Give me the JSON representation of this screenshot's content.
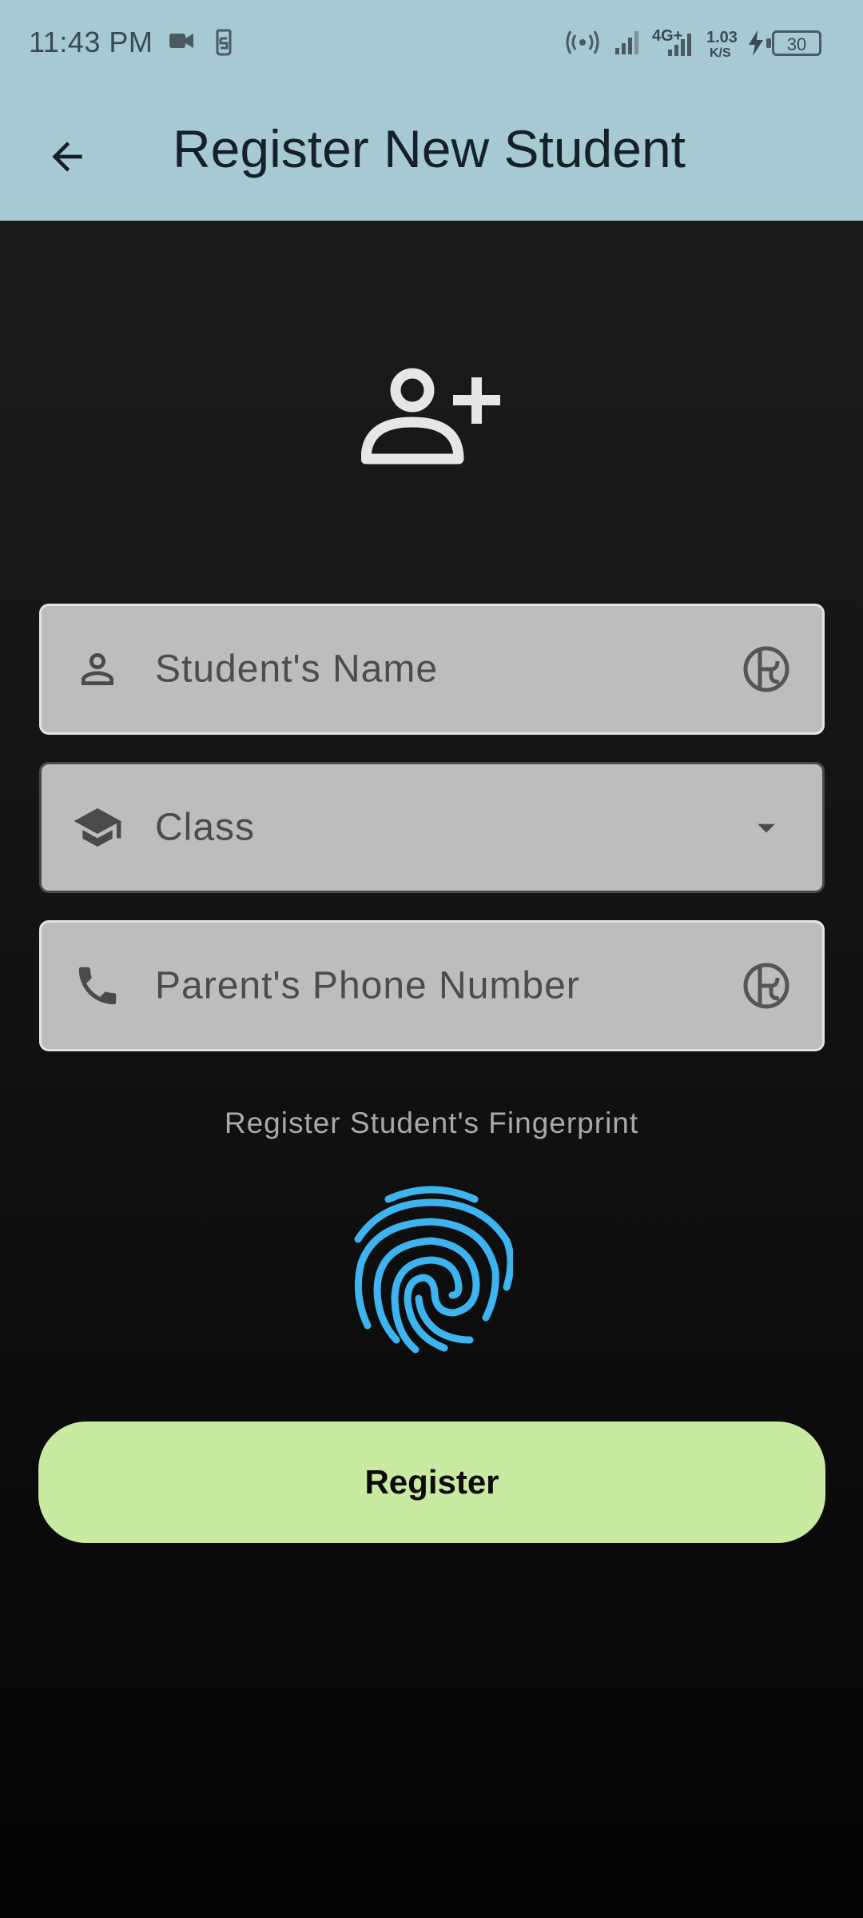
{
  "status_bar": {
    "time": "11:43 PM",
    "network_type": "4G+",
    "speed_value": "1.03",
    "speed_unit": "K/S",
    "battery": "30"
  },
  "app_bar": {
    "title": "Register New Student",
    "back_icon": "arrow-back-icon"
  },
  "form": {
    "hero_icon": "person-add-icon",
    "student_name": {
      "placeholder": "Student's Name",
      "value": ""
    },
    "class_select": {
      "placeholder": "Class",
      "value": ""
    },
    "parent_phone": {
      "placeholder": "Parent's Phone Number",
      "value": ""
    },
    "fingerprint_caption": "Register Student's Fingerprint",
    "register_label": "Register"
  },
  "colors": {
    "header_bg": "#a6c9d4",
    "field_bg": "#bdbdbd",
    "fingerprint": "#3db4f0",
    "button_bg": "#c9eba1"
  }
}
